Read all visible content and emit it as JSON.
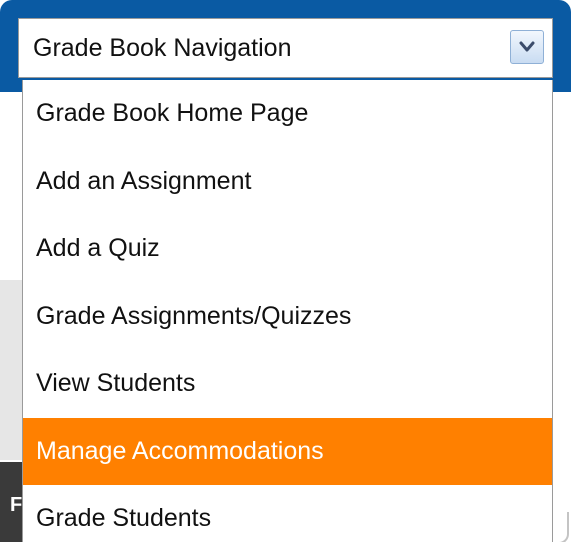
{
  "select": {
    "current_value": "Grade Book Navigation",
    "arrow_icon": "chevron-down-icon"
  },
  "dropdown": {
    "options": [
      {
        "label": "Grade Book Home Page",
        "selected": false
      },
      {
        "label": "Add an Assignment",
        "selected": false
      },
      {
        "label": "Add a Quiz",
        "selected": false
      },
      {
        "label": "Grade Assignments/Quizzes",
        "selected": false
      },
      {
        "label": "View Students",
        "selected": false
      },
      {
        "label": "Manage Accommodations",
        "selected": true
      },
      {
        "label": "Grade Students",
        "selected": false
      }
    ]
  },
  "background": {
    "partial_letter": "F"
  },
  "colors": {
    "header_blue": "#0a5aa3",
    "highlight_orange": "#ff8000"
  }
}
